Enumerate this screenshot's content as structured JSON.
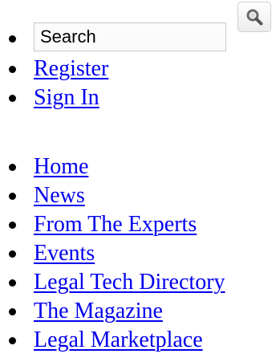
{
  "search": {
    "placeholder": "Search",
    "button_icon": "magnifier-icon"
  },
  "account_links": [
    {
      "label": "Register"
    },
    {
      "label": "Sign In"
    }
  ],
  "nav_links": [
    {
      "label": "Home"
    },
    {
      "label": "News"
    },
    {
      "label": "From The Experts"
    },
    {
      "label": "Events"
    },
    {
      "label": "Legal Tech Directory"
    },
    {
      "label": "The Magazine"
    },
    {
      "label": "Legal Marketplace"
    }
  ],
  "colors": {
    "link": "#0000ee",
    "text": "#000000",
    "input_border": "#c8c8c8"
  }
}
